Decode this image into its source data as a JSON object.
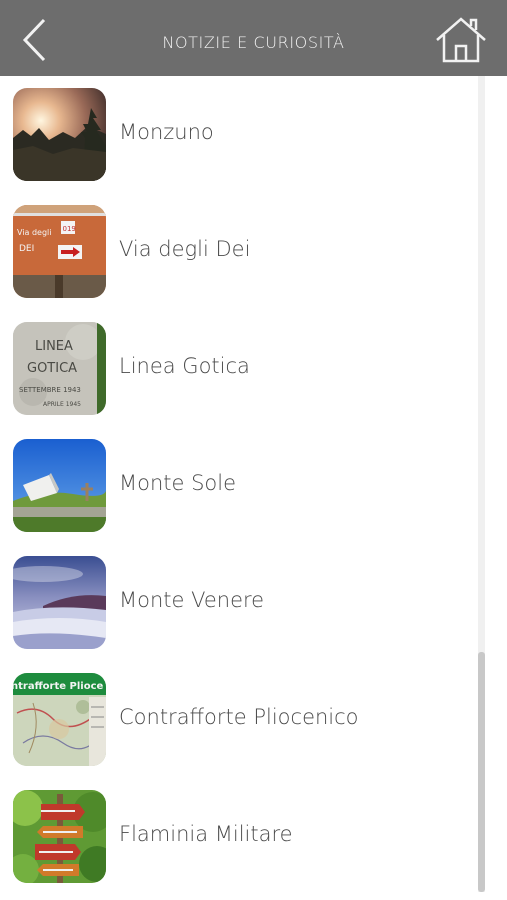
{
  "header": {
    "title": "NOTIZIE E CURIOSITÀ",
    "background": "#6d6d6d",
    "back_icon": "chevron-left-icon",
    "home_icon": "home-icon"
  },
  "items": [
    {
      "label": "Monzuno",
      "thumb": "mountain-sunset-photo"
    },
    {
      "label": "Via degli Dei",
      "thumb": "trail-sign-photo"
    },
    {
      "label": "Linea Gotica",
      "thumb": "engraved-stone-photo"
    },
    {
      "label": "Monte Sole",
      "thumb": "memorial-sky-photo"
    },
    {
      "label": "Monte Venere",
      "thumb": "cloud-sea-photo"
    },
    {
      "label": "Contrafforte Pliocenico",
      "thumb": "trail-map-photo"
    },
    {
      "label": "Flaminia Militare",
      "thumb": "signpost-forest-photo"
    }
  ],
  "thumb_texts": {
    "via_sign_line1": "Via degli",
    "via_sign_line2": "DEI",
    "via_sign_num": "019",
    "gotica_line1": "LINEA",
    "gotica_line2": "GOTICA",
    "gotica_line3": "SETTEMBRE 1943",
    "gotica_line4": "APRILE 1945",
    "contrafforte_banner": "ntrafforte Plioce"
  },
  "text_color": "#4a4a4a"
}
